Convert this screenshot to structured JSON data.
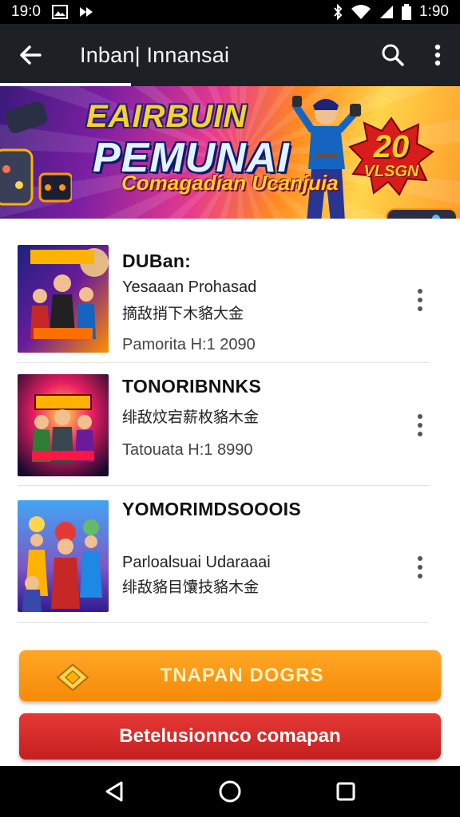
{
  "status_bar": {
    "time_left": "19:0",
    "time_right": "1:90",
    "icons": [
      "gallery-icon",
      "media-icon",
      "bluetooth-icon",
      "wifi-icon",
      "signal-icon",
      "battery-icon"
    ]
  },
  "app_bar": {
    "title": "Inban| Innansai",
    "icons": [
      "back-arrow-icon",
      "search-icon",
      "more-vert-icon"
    ]
  },
  "banner": {
    "line1": "EAIRBUIN",
    "line2": "PEMUNAI",
    "subtitle": "Comagadian Ucanjuia",
    "badge_number": "20",
    "badge_text": "VLSGN"
  },
  "items": [
    {
      "name": "DUBan:",
      "line1": "Yesaaan Prohasad",
      "line2": "摘敌捎下木貉大金",
      "line3": "Pamorita H:1 2090"
    },
    {
      "name": "TONORIBNNKS",
      "line1": "绯敌炆宕薪枚貉木金",
      "line2": "Tatouata H:1 8990"
    },
    {
      "name": "YOMORIMDSOOOIS",
      "line1": "Parloalsuai Udaraaai",
      "line2": "绯敌貉目馕技貉木金"
    }
  ],
  "buttons": {
    "primary": "TNAPAN DOGRS",
    "secondary": "Betelusionnco comapan"
  },
  "nav_bar": {
    "icons": [
      "back-triangle-icon",
      "home-circle-icon",
      "recents-square-icon"
    ]
  },
  "colors": {
    "app_bar": "#1d2126",
    "orange": "#f7931e",
    "red": "#d32828"
  }
}
